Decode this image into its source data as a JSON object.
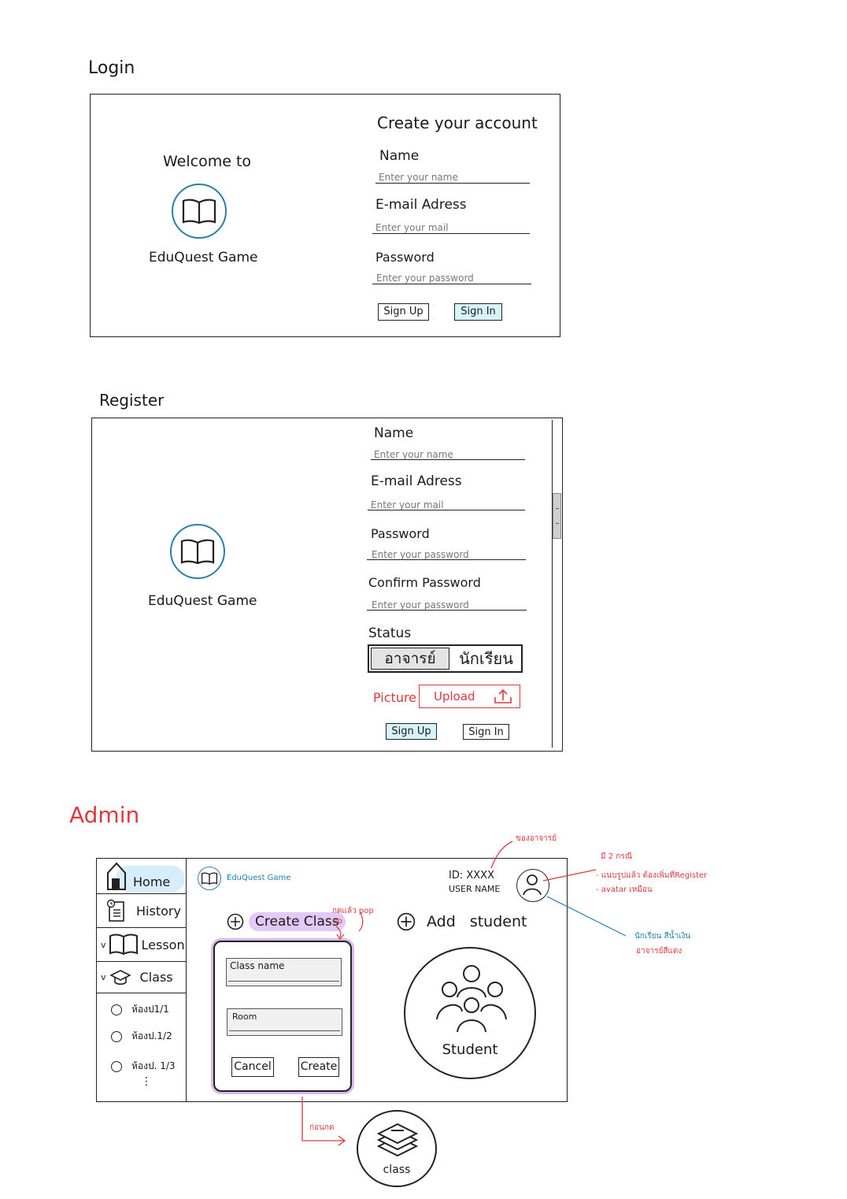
{
  "login": {
    "section_title": "Login",
    "welcome": "Welcome to",
    "app_name": "EduQuest Game",
    "form_title": "Create your account",
    "name_label": "Name",
    "name_placeholder": "Enter your name",
    "email_label": "E-mail Adress",
    "email_placeholder": "Enter your mail",
    "password_label": "Password",
    "password_placeholder": "Enter your password",
    "signup_label": "Sign Up",
    "signin_label": "Sign In"
  },
  "register": {
    "section_title": "Register",
    "app_name": "EduQuest Game",
    "name_label": "Name",
    "name_placeholder": "Enter your name",
    "email_label": "E-mail Adress",
    "email_placeholder": "Enter your mail",
    "password_label": "Password",
    "password_placeholder": "Enter your password",
    "confirm_label": "Confirm Password",
    "confirm_placeholder": "Enter your password",
    "status_label": "Status",
    "status_options": [
      "อาจารย์",
      "นักเรียน"
    ],
    "picture_label": "Picture",
    "upload_label": "Upload",
    "signup_label": "Sign Up",
    "signin_label": "Sign In"
  },
  "admin": {
    "section_title": "Admin",
    "sidebar": {
      "home": "Home",
      "history": "History",
      "lesson": "Lesson",
      "class": "Class",
      "rooms": [
        "ห้องป1/1",
        "ห้องป.1/2",
        "ห้องป. 1/3"
      ],
      "more": "⋮"
    },
    "header_app_name": "EduQuest Game",
    "user_id": "ID: XXXX",
    "user_name": "USER NAME",
    "create_class": "Create Class",
    "add_student": "Add student",
    "popup": {
      "class_name_placeholder": "Class name",
      "room_placeholder": "Room",
      "cancel": "Cancel",
      "create": "Create"
    },
    "student_label": "Student",
    "class_icon_label": "class",
    "notes": {
      "teacher_of": "ของอาจารย์",
      "press_popup": "กดแล้ว pop up",
      "before_press": "ก่อนกด",
      "cases_title": "มี 2 กรณี",
      "case1": "- แนบรูปแล้ว ต้องเพิ่มที่Register",
      "case2": "- avatar เหมือน",
      "student_color": "นักเรียน สีน้ำเงิน",
      "teacher_color": "อาจารย์สีแดง"
    }
  },
  "colors": {
    "accent_blue": "#2a7fa6",
    "button_blue": "#d6f2fb",
    "annotation_red": "#e0383b",
    "highlight_purple": "#e2c9f7",
    "popup_purple": "#b58be0"
  }
}
